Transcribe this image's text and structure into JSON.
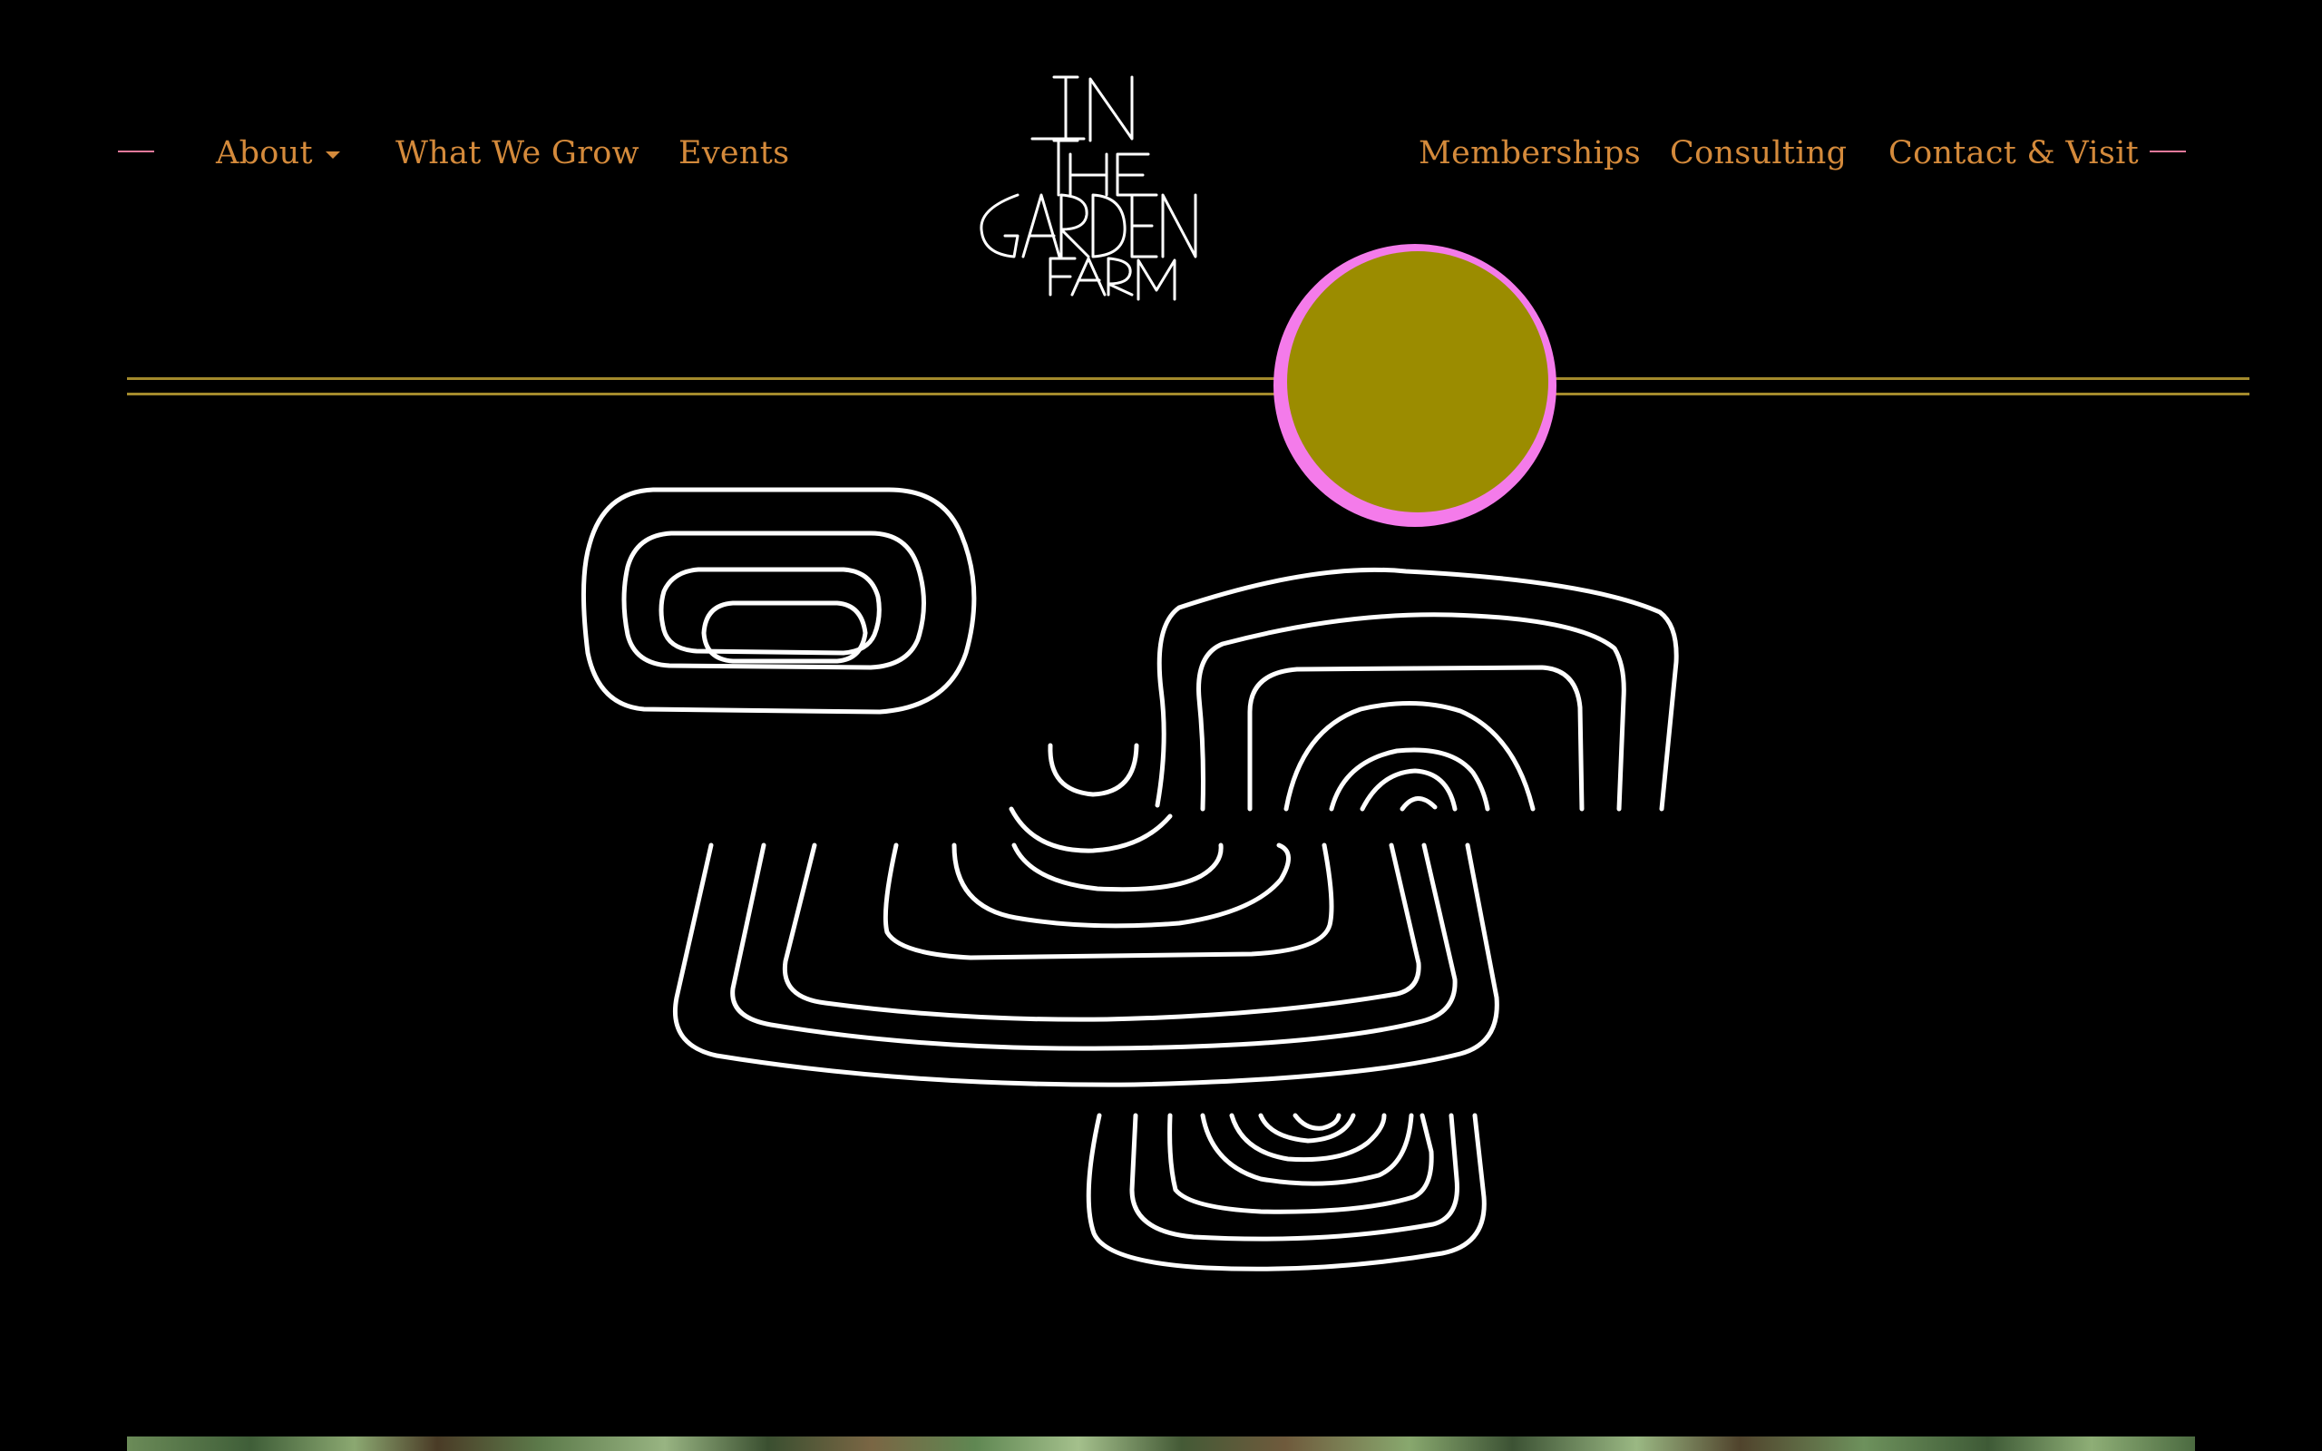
{
  "nav": {
    "left": [
      {
        "label": "About",
        "has_dropdown": true
      },
      {
        "label": "What We Grow"
      },
      {
        "label": "Events"
      }
    ],
    "right": [
      {
        "label": "Memberships"
      },
      {
        "label": "Consulting"
      },
      {
        "label": "Contact & Visit"
      }
    ]
  },
  "logo": {
    "text": "IN THE GARDEN FARM",
    "lines": [
      "IN",
      "THE",
      "GARDEN",
      "FARM"
    ]
  },
  "colors": {
    "background": "#000000",
    "nav_text": "#d48a3b",
    "nav_dash": "#e2799b",
    "horizon_line": "#a38a2c",
    "sun_fill": "#9b8c00",
    "sun_ring": "#f47bea",
    "art_stroke": "#ffffff"
  },
  "icons": {
    "dropdown": "caret-down-icon",
    "sun": "sun-icon",
    "field_rows": "garden-rows-illustration"
  }
}
